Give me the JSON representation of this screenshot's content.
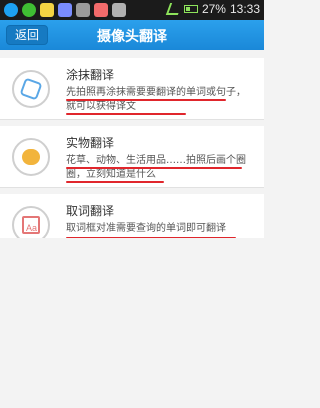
{
  "statusbar": {
    "battery": "27%",
    "time": "13:33"
  },
  "header": {
    "back_label": "返回",
    "title": "摄像头翻译"
  },
  "items": [
    {
      "title": "涂抹翻译",
      "desc": "先拍照再涂抹需要要翻译的单词或句子，就可以获得译文",
      "icon": "smear-icon"
    },
    {
      "title": "实物翻译",
      "desc": "花草、动物、生活用品……拍照后画个圈圈，立刻知道是什么",
      "icon": "object-icon"
    },
    {
      "title": "取词翻译",
      "desc": "取词框对准需要查询的单词即可翻译",
      "icon": "word-icon",
      "icon_text": "Aa"
    }
  ],
  "colors": {
    "accent": "#1a88d8",
    "underline": "#e0262c"
  }
}
